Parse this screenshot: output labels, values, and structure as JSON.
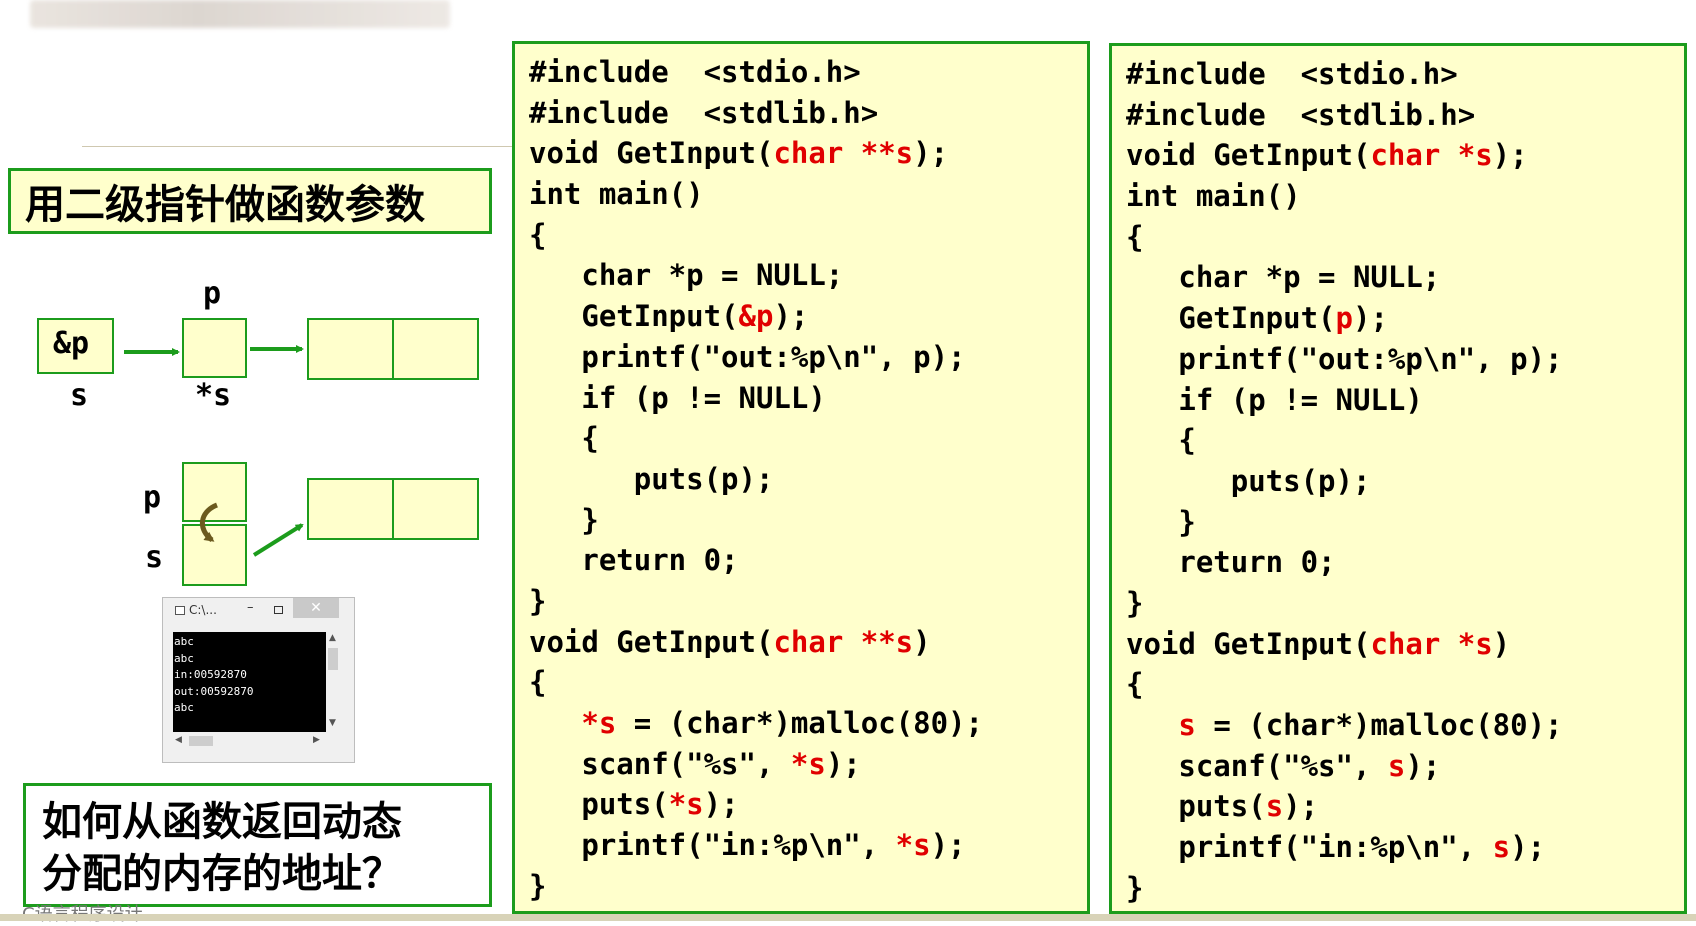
{
  "title": "用二级指针做函数参数",
  "question": [
    "如何从函数返回动态",
    "分配的内存的地址？"
  ],
  "footer": "C语言程序设计",
  "diagram": {
    "labels": {
      "amp_p": "&p",
      "s_top": "s",
      "p_top": "p",
      "star_s": "*s",
      "p_left": "p",
      "s_left": "s"
    }
  },
  "console": {
    "title": "C:\\...",
    "lines": [
      "abc",
      "abc",
      "in:00592870",
      "out:00592870",
      "abc"
    ]
  },
  "code_left": [
    [
      "#include  <stdio.h>"
    ],
    [
      "#include  <stdlib.h>"
    ],
    [
      "void GetInput(",
      {
        "h": "char **s"
      },
      ");"
    ],
    [
      "int main()"
    ],
    [
      "{"
    ],
    [
      "   char *p = NULL;"
    ],
    [
      "   GetInput(",
      {
        "h": "&p"
      },
      ");"
    ],
    [
      "   printf(\"out:%p\\n\", p);"
    ],
    [
      "   if (p != NULL)"
    ],
    [
      "   {"
    ],
    [
      "      puts(p);"
    ],
    [
      "   }"
    ],
    [
      "   return 0;"
    ],
    [
      "}"
    ],
    [
      "void GetInput(",
      {
        "h": "char **s"
      },
      ")"
    ],
    [
      "{"
    ],
    [
      "   ",
      {
        "h": "*s"
      },
      " = (char*)malloc(80);"
    ],
    [
      "   scanf(\"%s\", ",
      {
        "h": "*s"
      },
      ");"
    ],
    [
      "   puts(",
      {
        "h": "*s"
      },
      ");"
    ],
    [
      "   printf(\"in:%p\\n\", ",
      {
        "h": "*s"
      },
      ");"
    ],
    [
      "}"
    ]
  ],
  "code_right": [
    [
      "#include  <stdio.h>"
    ],
    [
      "#include  <stdlib.h>"
    ],
    [
      "void GetInput(",
      {
        "h": "char *s"
      },
      ");"
    ],
    [
      "int main()"
    ],
    [
      "{"
    ],
    [
      "   char *p = NULL;"
    ],
    [
      "   GetInput(",
      {
        "h": "p"
      },
      ");"
    ],
    [
      "   printf(\"out:%p\\n\", p);"
    ],
    [
      "   if (p != NULL)"
    ],
    [
      "   {"
    ],
    [
      "      puts(p);"
    ],
    [
      "   }"
    ],
    [
      "   return 0;"
    ],
    [
      "}"
    ],
    [
      "void GetInput(",
      {
        "h": "char *s"
      },
      ")"
    ],
    [
      "{"
    ],
    [
      "   ",
      {
        "h": "s"
      },
      " = (char*)malloc(80);"
    ],
    [
      "   scanf(\"%s\", ",
      {
        "h": "s"
      },
      ");"
    ],
    [
      "   puts(",
      {
        "h": "s"
      },
      ");"
    ],
    [
      "   printf(\"in:%p\\n\", ",
      {
        "h": "s"
      },
      ");"
    ],
    [
      "}"
    ]
  ],
  "colors": {
    "border": "#1c9c1c",
    "fill": "#ffffcc",
    "highlight": "#e00000",
    "arrow": "#1c9c1c",
    "curve_arrow": "#6b5a1e"
  }
}
